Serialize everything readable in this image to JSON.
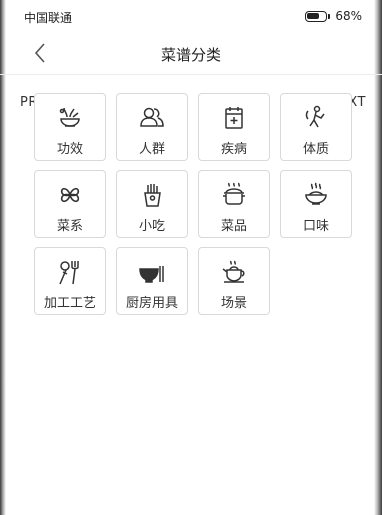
{
  "status_bar": {
    "carrier": "中国联通",
    "battery": "68%"
  },
  "header": {
    "title": "菜谱分类"
  },
  "pager": {
    "prev": "PREV",
    "next": "NEXT"
  },
  "categories": [
    {
      "label": "功效",
      "icon": "herb-bowl-icon"
    },
    {
      "label": "人群",
      "icon": "people-icon"
    },
    {
      "label": "疾病",
      "icon": "medical-calendar-icon"
    },
    {
      "label": "体质",
      "icon": "body-stretch-icon"
    },
    {
      "label": "菜系",
      "icon": "clover-icon"
    },
    {
      "label": "小吃",
      "icon": "fries-icon"
    },
    {
      "label": "菜品",
      "icon": "pot-icon"
    },
    {
      "label": "口味",
      "icon": "steaming-bowl-icon"
    },
    {
      "label": "加工工艺",
      "icon": "utensils-icon"
    },
    {
      "label": "厨房用具",
      "icon": "bowl-chopsticks-icon"
    },
    {
      "label": "场景",
      "icon": "teapot-icon"
    }
  ]
}
